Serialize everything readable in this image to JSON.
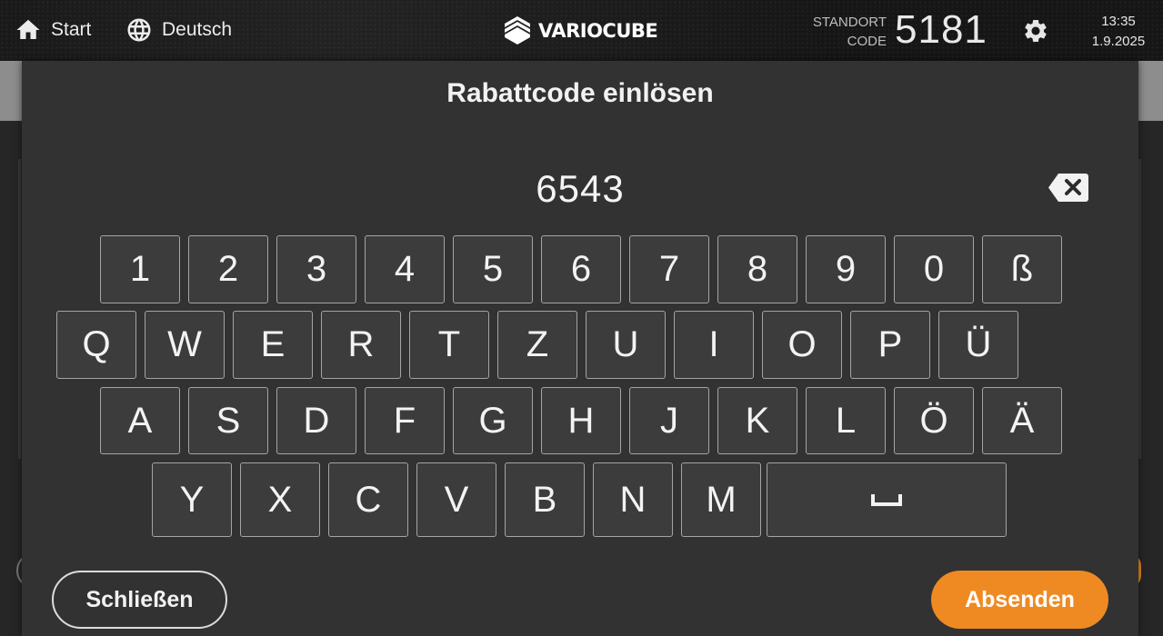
{
  "topbar": {
    "start_label": "Start",
    "language_label": "Deutsch",
    "logo_text": "VARIOCUBE",
    "standort_label_line1": "STANDORT",
    "standort_label_line2": "CODE",
    "standort_code": "5181",
    "time": "13:35",
    "date": "1.9.2025"
  },
  "modal": {
    "title": "Rabattcode einlösen",
    "input_value": "6543",
    "close_label": "Schließen",
    "submit_label": "Absenden",
    "submit_color": "#ef8a22"
  },
  "keyboard": {
    "row1": [
      "1",
      "2",
      "3",
      "4",
      "5",
      "6",
      "7",
      "8",
      "9",
      "0",
      "ß"
    ],
    "row2": [
      "Q",
      "W",
      "E",
      "R",
      "T",
      "Z",
      "U",
      "I",
      "O",
      "P",
      "Ü"
    ],
    "row3": [
      "A",
      "S",
      "D",
      "F",
      "G",
      "H",
      "J",
      "K",
      "L",
      "Ö",
      "Ä"
    ],
    "row4": [
      "Y",
      "X",
      "C",
      "V",
      "B",
      "N",
      "M"
    ]
  }
}
